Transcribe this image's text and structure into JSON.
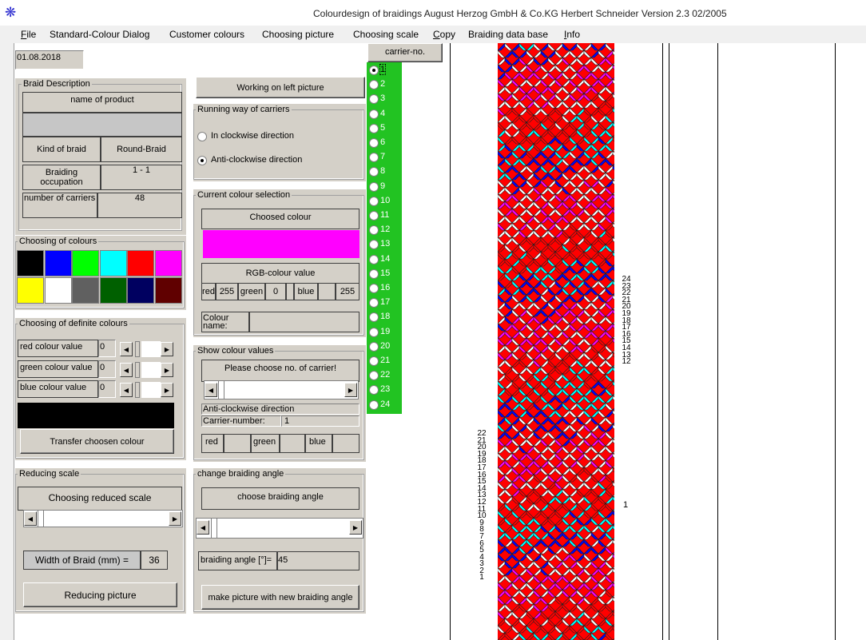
{
  "window": {
    "title": "Colourdesign of braidings  August Herzog GmbH & Co.KG   Herbert Schneider   Version 2.3     02/2005"
  },
  "menu": [
    {
      "label": "File",
      "u": "F",
      "rest": "ile"
    },
    {
      "label": "Standard-Colour Dialog"
    },
    {
      "label": "Customer colours"
    },
    {
      "label": "Choosing picture"
    },
    {
      "label": "Choosing scale"
    },
    {
      "label": "Copy",
      "u": "C",
      "rest": "opy"
    },
    {
      "label": "Braiding data base"
    },
    {
      "label": "Info",
      "u": "I",
      "rest": "nfo"
    }
  ],
  "date": "01.08.2018",
  "braid_description": {
    "group_label": "Braid Description",
    "name_of_product_label": "name of product",
    "name_of_product_value": "",
    "kind_of_braid_label": "Kind of braid",
    "kind_of_braid_value": "Round-Braid",
    "braiding_occupation_label": "Braiding occupation",
    "braiding_occupation_value": "1 - 1",
    "number_of_carriers_label": "number of carriers",
    "number_of_carriers_value": "48"
  },
  "choosing_colours": {
    "group_label": "Choosing of colours",
    "swatches": [
      "#000000",
      "#0000ff",
      "#00ff00",
      "#00ffff",
      "#ff0000",
      "#ff00ff",
      "#ffff00",
      "#ffffff",
      "#606060",
      "#006000",
      "#000060",
      "#600000"
    ]
  },
  "definite_colours": {
    "group_label": "Choosing of definite colours",
    "red_label": "red colour value",
    "red_value": "0",
    "green_label": "green colour value",
    "green_value": "0",
    "blue_label": "blue colour value",
    "blue_value": "0",
    "preview_color": "#000000",
    "transfer_button": "Transfer choosen colour"
  },
  "reducing_scale": {
    "group_label": "Reducing scale",
    "choosing_label": "Choosing reduced scale",
    "width_label": "Width of Braid (mm) =",
    "width_value": "36",
    "reduce_button": "Reducing picture"
  },
  "working_on": "Working on left picture",
  "running_way": {
    "group_label": "Running way of carriers",
    "clockwise": "In clockwise direction",
    "anticlockwise": "Anti-clockwise direction",
    "selected": "anticlockwise"
  },
  "current_colour": {
    "group_label": "Current colour selection",
    "choosed_label": "Choosed colour",
    "choosed_color": "#ff00ff",
    "rgb_label": "RGB-colour value",
    "red_label": "red",
    "red_value": "255",
    "green_label": "green",
    "green_value": "0",
    "blue_label": "blue",
    "blue_value": "255",
    "colour_name_label": "Colour name:"
  },
  "show_colour_values": {
    "group_label": "Show colour values",
    "prompt": "Please choose no. of carrier!",
    "direction": "Anti-clockwise direction",
    "carrier_number_label": "Carrier-number:",
    "carrier_number_value": "1",
    "red_label": "red",
    "green_label": "green",
    "blue_label": "blue"
  },
  "braiding_angle": {
    "group_label": "change braiding angle",
    "choose_label": "choose braiding angle",
    "angle_label": "braiding angle [°]=",
    "angle_value": "45",
    "make_button": "make picture with new braiding angle"
  },
  "carrier_panel": {
    "header": "carrier-no.",
    "bg_color": "#22c322",
    "selected": 1,
    "items": [
      "1",
      "2",
      "3",
      "4",
      "5",
      "6",
      "7",
      "8",
      "9",
      "10",
      "11",
      "12",
      "13",
      "14",
      "15",
      "16",
      "17",
      "18",
      "19",
      "20",
      "21",
      "22",
      "23",
      "24"
    ]
  },
  "braid_picture": {
    "colors": [
      "#ff0000",
      "#00ffff",
      "#0000ff",
      "#ffffff",
      "#ff00ff",
      "#ffffff"
    ],
    "left_numbers": [
      "22",
      "21",
      "20",
      "19",
      "18",
      "17",
      "16",
      "15",
      "14",
      "13",
      "12",
      "11",
      "10",
      "9",
      "8",
      "7",
      "6",
      "5",
      "4",
      "3",
      "2",
      "1"
    ],
    "right_numbers_top": [
      "24",
      "23",
      "22",
      "21",
      "20",
      "19",
      "18",
      "17",
      "16",
      "15",
      "14",
      "13",
      "12"
    ],
    "right_number_single": "1"
  }
}
